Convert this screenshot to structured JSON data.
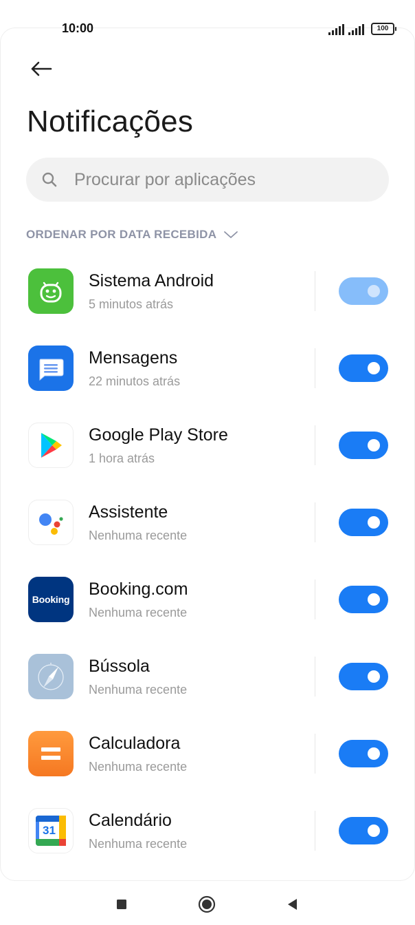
{
  "status_bar": {
    "time": "10:00",
    "battery": "100"
  },
  "header": {
    "title": "Notificações"
  },
  "search": {
    "placeholder": "Procurar por aplicações"
  },
  "sort": {
    "label": "ORDENAR POR DATA RECEBIDA"
  },
  "apps": [
    {
      "name": "Sistema Android",
      "subtitle": "5 minutos atrás",
      "icon": "android-system-icon",
      "enabled": true,
      "toggle_disabled": true
    },
    {
      "name": "Mensagens",
      "subtitle": "22 minutos atrás",
      "icon": "messages-icon",
      "enabled": true
    },
    {
      "name": "Google Play Store",
      "subtitle": "1 hora atrás",
      "icon": "play-store-icon",
      "enabled": true
    },
    {
      "name": "Assistente",
      "subtitle": "Nenhuma recente",
      "icon": "assistant-icon",
      "enabled": true
    },
    {
      "name": "Booking.com",
      "subtitle": "Nenhuma recente",
      "icon": "booking-icon",
      "icon_text": "Booking",
      "enabled": true
    },
    {
      "name": "Bússola",
      "subtitle": "Nenhuma recente",
      "icon": "compass-icon",
      "enabled": true
    },
    {
      "name": "Calculadora",
      "subtitle": "Nenhuma recente",
      "icon": "calculator-icon",
      "enabled": true
    },
    {
      "name": "Calendário",
      "subtitle": "Nenhuma recente",
      "icon": "calendar-icon",
      "icon_text": "31",
      "enabled": true
    }
  ],
  "colors": {
    "accent": "#1a7cf5",
    "accent_disabled": "#86bdfa",
    "sort_label": "#8e93a6"
  }
}
